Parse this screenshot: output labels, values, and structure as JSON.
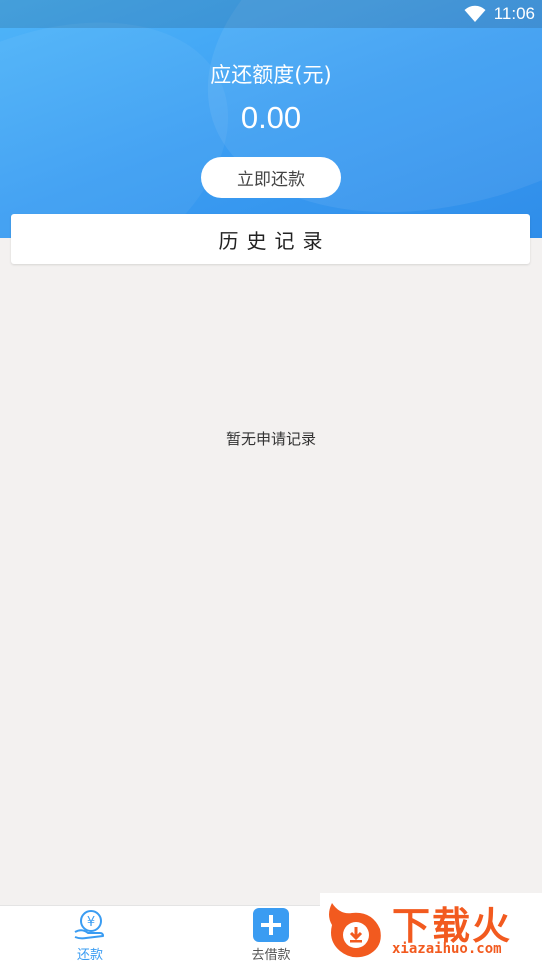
{
  "status_bar": {
    "time": "11:06",
    "wifi_icon": "wifi-icon"
  },
  "header": {
    "due_label": "应还额度(元)",
    "due_amount": "0.00",
    "repay_button_label": "立即还款"
  },
  "history": {
    "title": "历史记录",
    "empty_text": "暂无申请记录"
  },
  "bottom_nav": {
    "items": [
      {
        "label": "还款",
        "icon": "yuan-hand-icon",
        "active": true
      },
      {
        "label": "去借款",
        "icon": "plus-icon",
        "active": false
      }
    ]
  },
  "watermark": {
    "text": "下载火",
    "url": "xiazaihuo.com",
    "logo": "flame-logo"
  },
  "colors": {
    "accent": "#3a9cf2",
    "background": "#f3f1f0",
    "watermark": "#f25a1f"
  }
}
